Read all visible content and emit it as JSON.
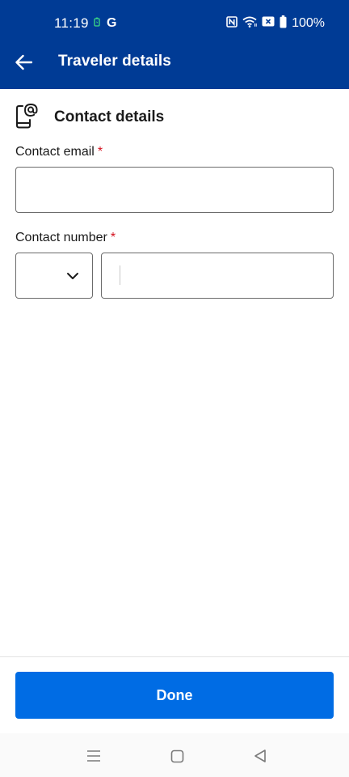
{
  "status_bar": {
    "time": "11:19",
    "carrier_glyph": "G",
    "battery_percent": "100%",
    "icons": [
      "battery-saver-icon",
      "google-icon",
      "nfc-icon",
      "wifi-icon",
      "no-sim-icon",
      "battery-icon"
    ]
  },
  "header": {
    "title": "Traveler details",
    "back_icon": "arrow-left-icon",
    "background_color": "#003b95"
  },
  "contact_section": {
    "title": "Contact details",
    "icon": "phone-at-icon",
    "email": {
      "label": "Contact email",
      "required_marker": "*",
      "value": "",
      "placeholder": ""
    },
    "phone": {
      "label": "Contact number",
      "required_marker": "*",
      "country_code_value": "",
      "value": "",
      "placeholder": ""
    }
  },
  "footer": {
    "done_label": "Done",
    "button_color": "#006ce4"
  },
  "system_nav": {
    "icons": [
      "menu-icon",
      "home-icon",
      "back-triangle-icon"
    ]
  }
}
